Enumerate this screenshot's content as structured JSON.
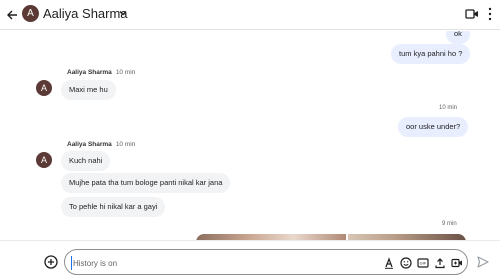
{
  "header": {
    "back_label": "←",
    "avatar_initial": "A",
    "contact_name": "Aaliya Sharma"
  },
  "messages": {
    "out_ok": "ok",
    "out_1": "tum kya pahni ho ?",
    "in_group_1": {
      "sender": "Aaliya Sharma",
      "time": "10 min",
      "avatar_initial": "A",
      "texts": [
        "Maxi me hu"
      ]
    },
    "out_time_2": "10 min",
    "out_2": "oor uske under?",
    "in_group_2": {
      "sender": "Aaliya Sharma",
      "time": "10 min",
      "avatar_initial": "A",
      "texts": [
        "Kuch nahi",
        "Mujhe pata tha tum bologe panti nikal kar jana",
        "To pehle hi nikal kar a gayi"
      ]
    },
    "out_time_3": "9 min"
  },
  "composer": {
    "placeholder": "History is on"
  },
  "colors": {
    "avatar": "#5b3a35",
    "outgoing_bubble": "#e8eefe",
    "incoming_bubble": "#f1f3f4"
  }
}
